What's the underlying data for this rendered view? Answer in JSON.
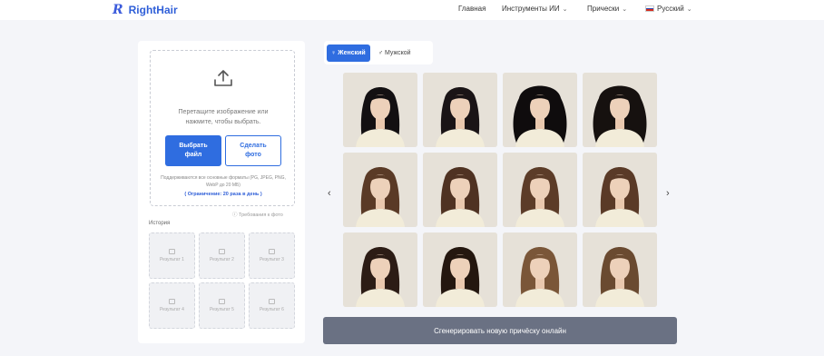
{
  "header": {
    "logo_mark": "R",
    "logo_text": "RightHair",
    "nav": [
      {
        "label": "Главная"
      },
      {
        "label": "Инструменты ИИ"
      },
      {
        "label": "Прически"
      },
      {
        "label": "Русский"
      }
    ]
  },
  "upload": {
    "drop_text": "Перетащите изображение или нажмите, чтобы выбрать.",
    "select_button": "Выбрать файл",
    "photo_button": "Сделать фото",
    "formats": "Поддерживаются все основные форматы (PG, JPEG, PNG, WebP до 20 МБ)",
    "limit": "( Ограничение: 20 раза в день )",
    "requirements": "ⓘ Требования к фото"
  },
  "history": {
    "title": "История",
    "slots": [
      "Результат 1",
      "Результат 2",
      "Результат 3",
      "Результат 4",
      "Результат 5",
      "Результат 6"
    ]
  },
  "tabs": {
    "female": "Женский",
    "male": "Мужской"
  },
  "gallery": {
    "hair_colors": [
      "#131012",
      "#1a1416",
      "#0f0c0d",
      "#16110f",
      "#5a3a26",
      "#4f3222",
      "#5c3c28",
      "#5a3a27",
      "#2c1c15",
      "#24170f",
      "#7a5638",
      "#6a4a30"
    ]
  },
  "generate_button": "Сгенерировать новую причёску онлайн",
  "colors": {
    "accent": "#2f6de0",
    "generate_bg": "#6a7183",
    "page_bg": "#f4f5f9"
  }
}
